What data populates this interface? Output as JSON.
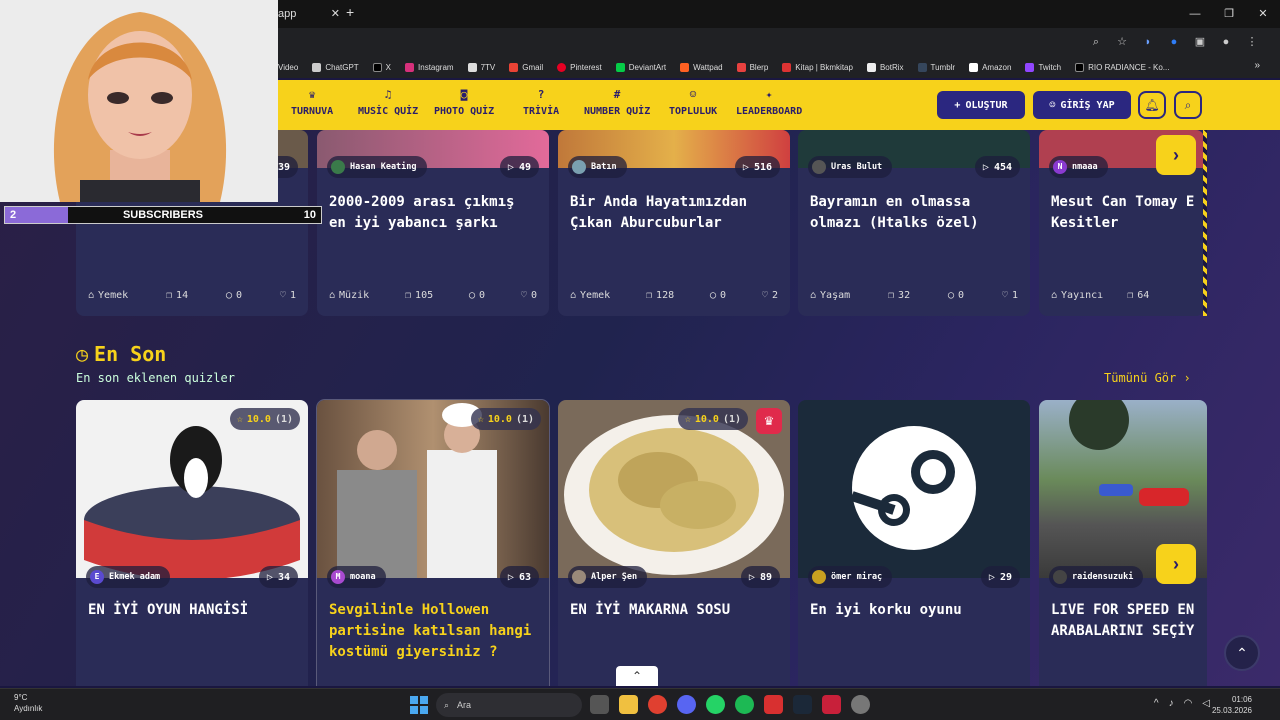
{
  "browser": {
    "tab_title": "app",
    "bookmarks": [
      "Video",
      "ChatGPT",
      "X",
      "Instagram",
      "7TV",
      "Gmail",
      "Pinterest",
      "DeviantArt",
      "Wattpad",
      "Blerp",
      "Kitap | Bkmkitap",
      "BotRix",
      "Tumblr",
      "Amazon",
      "Twitch",
      "RIO RADIANCE - Ko..."
    ]
  },
  "nav": {
    "items": [
      "TURNUVA",
      "MUSİC QUİZ",
      "PHOTO QUİZ",
      "TRİVİA",
      "NUMBER QUİZ",
      "TOPLULUK",
      "LEADERBOARD"
    ],
    "create_label": "OLUŞTUR",
    "login_label": "GİRİŞ YAP"
  },
  "row1": [
    {
      "author": "",
      "plays": "39",
      "title": "",
      "category": "Yemek",
      "questions": "14",
      "comments": "0",
      "likes": "1"
    },
    {
      "author": "Hasan Keating",
      "plays": "49",
      "title": "2000-2009 arası çıkmış en iyi yabancı şarkı",
      "category": "Müzik",
      "questions": "105",
      "comments": "0",
      "likes": "0"
    },
    {
      "author": "Batın",
      "plays": "516",
      "title": "Bir Anda Hayatımızdan Çıkan Aburcuburlar",
      "category": "Yemek",
      "questions": "128",
      "comments": "0",
      "likes": "2"
    },
    {
      "author": "Uras Bulut",
      "plays": "454",
      "title": "Bayramın en olmassa olmazı (Htalks özel)",
      "category": "Yaşam",
      "questions": "32",
      "comments": "0",
      "likes": "1"
    },
    {
      "author": "nmaaa",
      "plays": "",
      "title": "Mesut Can Tomay E Kesitler",
      "category": "Yayıncı",
      "questions": "64",
      "comments": "",
      "likes": ""
    }
  ],
  "section": {
    "title": "En Son",
    "subtitle": "En son eklenen quizler",
    "see_all": "Tümünü Gör ›"
  },
  "row2": [
    {
      "author": "Ekmek adam",
      "author_initial": "E",
      "plays": "34",
      "rating": "10.0",
      "rating_count": "(1)",
      "title": "EN İYİ OYUN HANGİSİ"
    },
    {
      "author": "moana",
      "author_initial": "M",
      "plays": "63",
      "rating": "10.0",
      "rating_count": "(1)",
      "title": "Sevgilinle Hollowen partisine katılsan hangi kostümü giyersiniz ?"
    },
    {
      "author": "Alper Şen",
      "author_initial": "",
      "plays": "89",
      "rating": "10.0",
      "rating_count": "(1)",
      "title": "EN İYİ MAKARNA SOSU"
    },
    {
      "author": "ömer miraç",
      "author_initial": "",
      "plays": "29",
      "rating": "",
      "rating_count": "",
      "title": "En iyi korku oyunu"
    },
    {
      "author": "raidensuzuki",
      "author_initial": "",
      "plays": "",
      "rating": "",
      "rating_count": "",
      "title": "LIVE FOR SPEED EN ARABALARINI SEÇİY"
    }
  ],
  "overlay": {
    "sub_current": "2",
    "sub_label": "SUBSCRIBERS",
    "sub_goal": "10",
    "sub_progress": 0.2
  },
  "taskbar": {
    "temp": "9°C",
    "weather": "Aydınlık",
    "search": "Ara",
    "time": "01:06",
    "date": "25.03.2026"
  },
  "colors": {
    "accent": "#f7d21b",
    "navy": "#2b2780",
    "card": "#2a2c57"
  }
}
